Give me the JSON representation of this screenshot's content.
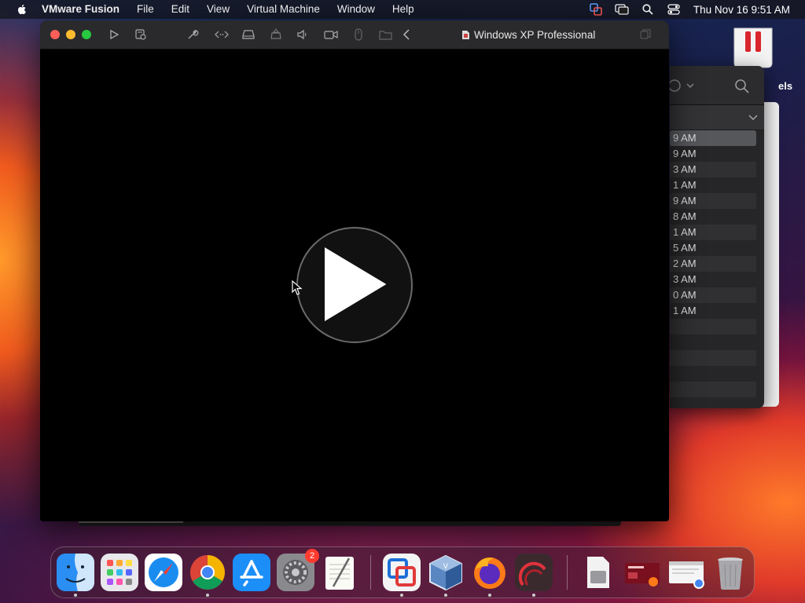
{
  "menubar": {
    "app_name": "VMware Fusion",
    "menus": [
      "File",
      "Edit",
      "View",
      "Virtual Machine",
      "Window",
      "Help"
    ],
    "clock": "Thu Nov 16  9:51 AM"
  },
  "vm_window": {
    "title": "Windows XP Professional"
  },
  "background_window": {
    "label": "els",
    "times": [
      "9 AM",
      "9 AM",
      "3 AM",
      "1 AM",
      "9 AM",
      "8 AM",
      "1 AM",
      "5 AM",
      "2 AM",
      "3 AM",
      "0 AM",
      "1 AM"
    ]
  },
  "dock": {
    "items": [
      "Finder",
      "Launchpad",
      "Safari",
      "Google Chrome",
      "App Store",
      "System Settings",
      "TextEdit",
      "VMware Fusion",
      "VirtualBox",
      "Firefox",
      "Parallels",
      "Document",
      "Presentation",
      "Chrome Window",
      "Trash"
    ],
    "system_settings_badge": "2"
  },
  "colors": {
    "close": "#ff5f57",
    "minimize": "#febc2e",
    "maximize": "#28c840",
    "badge": "#ff3b30"
  }
}
